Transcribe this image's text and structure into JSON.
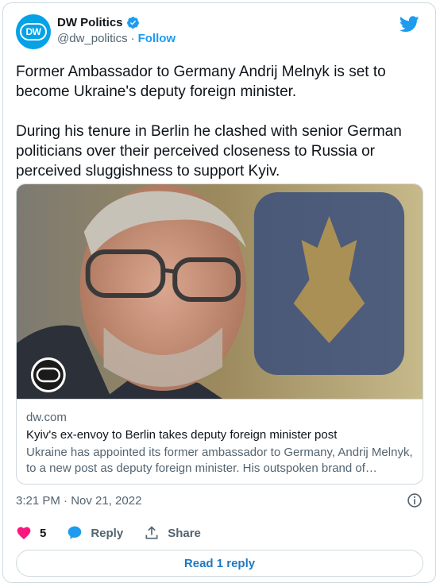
{
  "author": {
    "display_name": "DW Politics",
    "handle": "@dw_politics",
    "follow_label": "Follow",
    "avatar_text": "DW"
  },
  "tweet": {
    "paragraphs": [
      "Former Ambassador to Germany Andrij Melnyk is set to become Ukraine's deputy foreign minister.",
      "During his tenure in Berlin he clashed with senior German politicians over their perceived closeness to Russia or perceived sluggishness to support Kyiv."
    ]
  },
  "link_card": {
    "image_logo": "DW",
    "domain": "dw.com",
    "title": "Kyiv's ex-envoy to Berlin takes deputy foreign minister post",
    "description": "Ukraine has appointed its former ambassador to Germany, Andrij Melnyk, to a new post as deputy foreign minister. His outspoken brand of diplomacy..."
  },
  "timestamp": "3:21 PM · Nov 21, 2022",
  "actions": {
    "like_count": "5",
    "reply_label": "Reply",
    "share_label": "Share"
  },
  "read_reply_label": "Read 1 reply",
  "colors": {
    "twitter_blue": "#1d9bf0",
    "like_red": "#f91880",
    "dw_blue": "#05a2e5"
  },
  "icons": [
    "verified-badge-icon",
    "twitter-bird-icon",
    "info-icon",
    "heart-icon",
    "speech-bubble-icon",
    "share-upload-icon"
  ]
}
